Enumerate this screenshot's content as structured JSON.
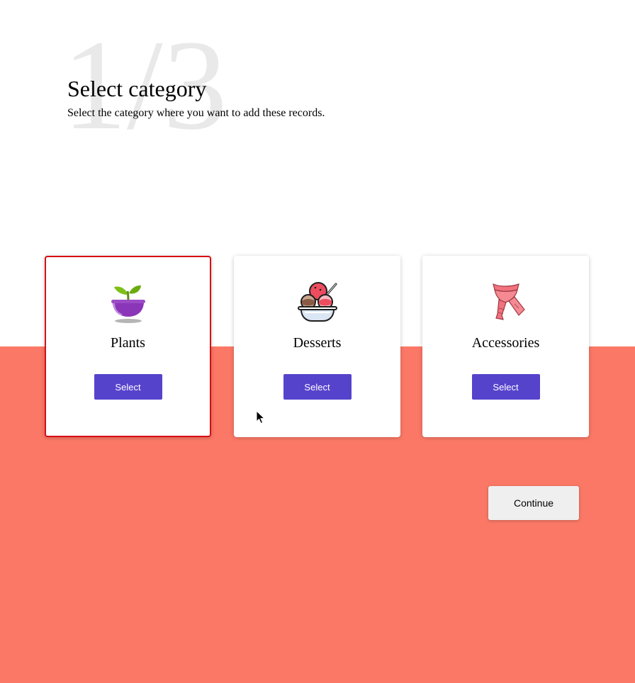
{
  "step": {
    "indicator": "1/3"
  },
  "header": {
    "title": "Select category",
    "subtitle": "Select the category where you want to add these records."
  },
  "categories": [
    {
      "label": "Plants",
      "icon": "plant-pot-icon",
      "button_label": "Select",
      "selected": true
    },
    {
      "label": "Desserts",
      "icon": "ice-cream-bowl-icon",
      "button_label": "Select",
      "selected": false
    },
    {
      "label": "Accessories",
      "icon": "scarf-icon",
      "button_label": "Select",
      "selected": false
    }
  ],
  "footer": {
    "continue_label": "Continue"
  },
  "colors": {
    "background_bottom": "#fb7866",
    "select_button": "#5643cc",
    "selected_border": "#d60f15",
    "continue_button": "#efefef"
  }
}
